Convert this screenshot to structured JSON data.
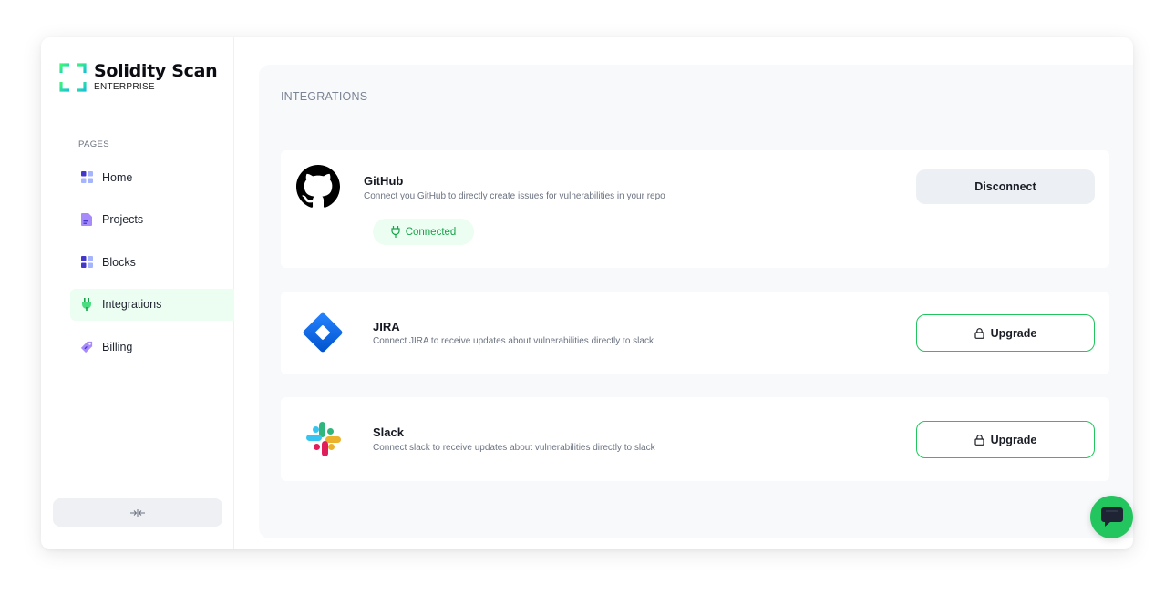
{
  "brand": {
    "name": "Solidity Scan",
    "tier": "ENTERPRISE",
    "accent_color": "#22c55e"
  },
  "sidebar": {
    "section_label": "PAGES",
    "items": [
      {
        "label": "Home",
        "icon": "grid-icon",
        "active": false
      },
      {
        "label": "Projects",
        "icon": "document-icon",
        "active": false
      },
      {
        "label": "Blocks",
        "icon": "grid-icon",
        "active": false
      },
      {
        "label": "Integrations",
        "icon": "plug-icon",
        "active": true
      },
      {
        "label": "Billing",
        "icon": "tag-icon",
        "active": false
      }
    ],
    "collapse_icon": "collapse-arrows-icon"
  },
  "main": {
    "title": "INTEGRATIONS",
    "integrations": [
      {
        "name": "GitHub",
        "description": "Connect you GitHub to directly create issues for vulnerabilities in your repo",
        "status": "Connected",
        "action": "Disconnect",
        "icon": "github-icon"
      },
      {
        "name": "JIRA",
        "description": "Connect JIRA to receive updates about vulnerabilities directly to slack",
        "action": "Upgrade",
        "icon": "jira-icon"
      },
      {
        "name": "Slack",
        "description": "Connect slack to receive updates about vulnerabilities directly to slack",
        "action": "Upgrade",
        "icon": "slack-icon"
      }
    ]
  },
  "chat": {
    "icon": "chat-bubble-icon"
  }
}
